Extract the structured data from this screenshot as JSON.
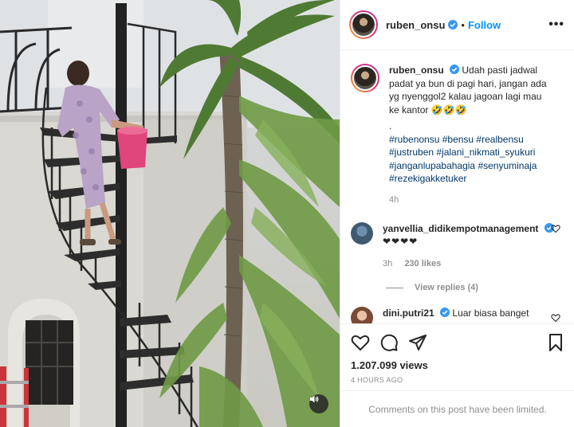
{
  "post": {
    "author": "ruben_onsu",
    "follow_label": "Follow",
    "more_glyph": "•••",
    "separator": "•",
    "caption": {
      "author": "ruben_onsu",
      "text": "Udah pasti jadwal padat ya bun di pagi hari, jangan ada yg nyenggol2 kalau jagoan lagi mau ke kantor 🤣🤣🤣",
      "dot": ".",
      "hashtags": "#rubenonsu #bensu #realbensu #justruben #jalani_nikmati_syukuri #janganlupabahagia #senyuminaja #rezekigakketuker",
      "time": "4h"
    },
    "comments": [
      {
        "author": "yanvellia_didikempotmanagement",
        "text": "❤❤❤❤",
        "time": "3h",
        "likes": "230 likes",
        "view_replies": "View replies (4)"
      },
      {
        "author": "dini.putri21",
        "text": "Luar biasa banget"
      }
    ],
    "views": "1.207.099 views",
    "posted_ago": "4 HOURS AGO",
    "comments_limited": "Comments on this post have been limited."
  },
  "icons": {
    "verified": "verified-badge-icon",
    "like": "heart-icon",
    "comment": "comment-bubble-icon",
    "share": "paper-plane-icon",
    "save": "bookmark-icon",
    "sound": "speaker-icon"
  },
  "colors": {
    "accent": "#0095f6",
    "hashtag": "#00376b",
    "muted": "#8e8e8e"
  }
}
